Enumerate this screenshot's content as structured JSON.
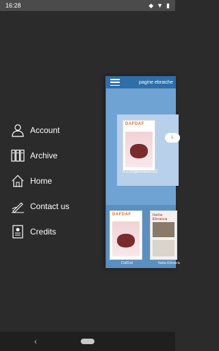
{
  "status_bar": {
    "time": "16:28"
  },
  "menu": {
    "items": [
      {
        "label": "Account",
        "icon": "user-icon"
      },
      {
        "label": "Archive",
        "icon": "archive-icon"
      },
      {
        "label": "Home",
        "icon": "home-icon"
      },
      {
        "label": "Contact us",
        "icon": "contact-icon"
      },
      {
        "label": "Credits",
        "icon": "credits-icon"
      }
    ]
  },
  "app_preview": {
    "title": "pagine ebraiche",
    "featured_issue": {
      "caption": "n.129/gennaio2022",
      "logo": "DAFDAF"
    },
    "thumbs": [
      {
        "label": "DafDaf",
        "logo": "DAFDAF"
      },
      {
        "label": "Italia Ebraica",
        "logo": "Italia Ebraica"
      }
    ]
  },
  "colors": {
    "drawer_bg": "#2b2b2b",
    "app_header": "#2f6ea8",
    "app_bg": "#6fa3d3"
  }
}
